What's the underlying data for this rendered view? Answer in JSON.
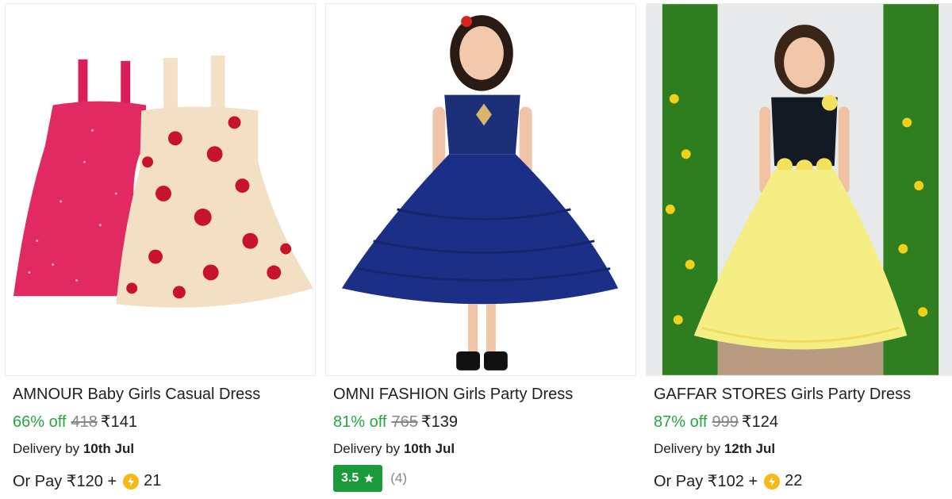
{
  "products": [
    {
      "title": "AMNOUR Baby Girls Casual Dress",
      "discount": "66% off",
      "mrp": "418",
      "price": "₹141",
      "delivery_prefix": "Delivery by",
      "delivery_date": "10th Jul",
      "pay_text": "Or Pay ₹120 +",
      "coins": "21"
    },
    {
      "title": "OMNI FASHION Girls Party Dress",
      "discount": "81% off",
      "mrp": "765",
      "price": "₹139",
      "delivery_prefix": "Delivery by",
      "delivery_date": "10th Jul",
      "rating": "3.5",
      "rating_count": "(4)"
    },
    {
      "title": "GAFFAR STORES Girls Party Dress",
      "discount": "87% off",
      "mrp": "999",
      "price": "₹124",
      "delivery_prefix": "Delivery by",
      "delivery_date": "12th Jul",
      "pay_text": "Or Pay ₹102 +",
      "coins": "22"
    }
  ],
  "colors": {
    "discount": "#26a541",
    "rating_badge": "#1b9a3c",
    "coin": "#f6b915"
  },
  "icons": [
    "star-icon",
    "supercoin-icon"
  ]
}
